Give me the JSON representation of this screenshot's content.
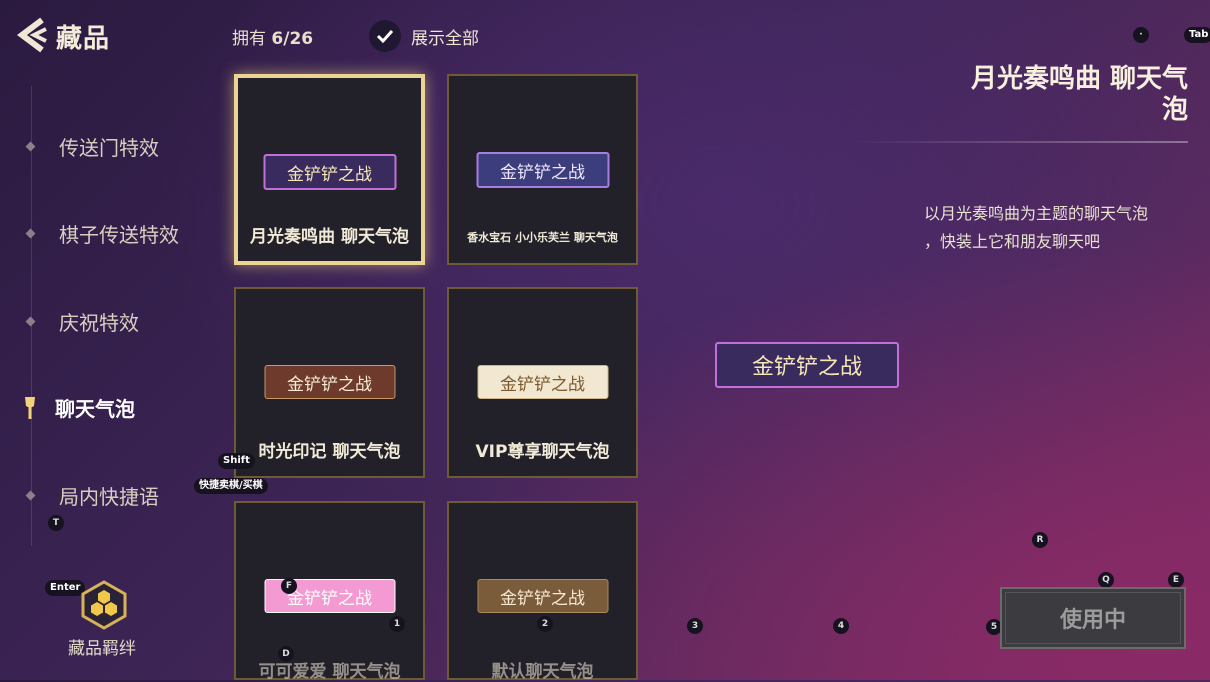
{
  "header": {
    "title": "藏品",
    "owned_label": "拥有",
    "owned_count": "6/26",
    "show_all_label": "展示全部"
  },
  "hotkeys": {
    "top_circle": "·",
    "tab": "Tab",
    "shift": "Shift",
    "shift_tip": "快捷卖棋/买棋",
    "t": "T",
    "enter": "Enter",
    "f": "F",
    "d": "D",
    "k1": "1",
    "k2": "2",
    "k3": "3",
    "k4": "4",
    "k5": "5",
    "r": "R",
    "q": "Q",
    "e": "E"
  },
  "sidebar": {
    "items": [
      {
        "label": "传送门特效"
      },
      {
        "label": "棋子传送特效"
      },
      {
        "label": "庆祝特效"
      },
      {
        "label": "聊天气泡"
      },
      {
        "label": "局内快捷语"
      }
    ],
    "bond_label": "藏品羁绊"
  },
  "cards": [
    {
      "bubble": "金铲铲之战",
      "name": "月光奏鸣曲  聊天气泡"
    },
    {
      "bubble": "金铲铲之战",
      "name": "香水宝石  小小乐芙兰  聊天气泡"
    },
    {
      "bubble": "金铲铲之战",
      "name": "时光印记  聊天气泡"
    },
    {
      "bubble": "金铲铲之战",
      "name": "VIP尊享聊天气泡"
    },
    {
      "bubble": "金铲铲之战",
      "name": "可可爱爱  聊天气泡"
    },
    {
      "bubble": "金铲铲之战",
      "name": "默认聊天气泡"
    }
  ],
  "detail": {
    "title_line1": "月光奏鸣曲  聊天气",
    "title_line2": "泡",
    "desc_line1": "以月光奏鸣曲为主题的聊天气泡",
    "desc_line2": "，快装上它和朋友聊天吧",
    "preview": "金铲铲之战",
    "use_button": "使用中"
  },
  "colors": {
    "selected_border": "#ecd493",
    "card_border": "#6e5a33",
    "card_bg": "#222028"
  }
}
